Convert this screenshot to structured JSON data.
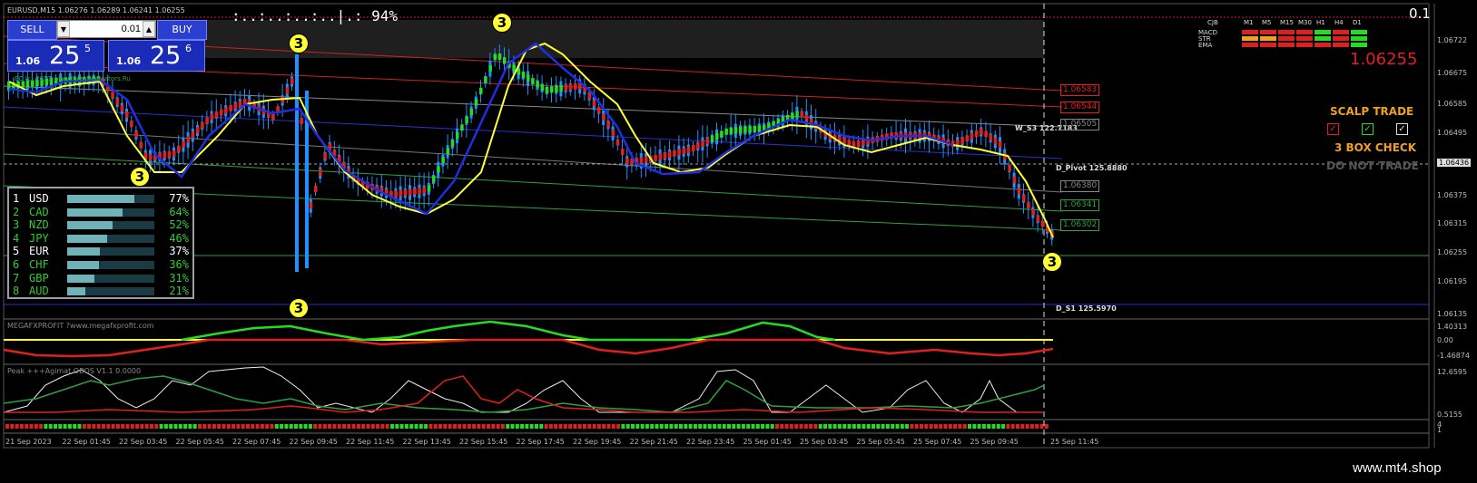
{
  "chart": {
    "symbol_line": "EURUSD,M15  1.06276 1.06289 1.06241 1.06255",
    "timer": ":..:..:..:..|.: 94%",
    "top_right_value": "0.1",
    "watermark": "www.mt4.shop",
    "credit": "EC (c) 2023 www.forex-indicators.Ru"
  },
  "trade_panel": {
    "sell_label": "SELL",
    "buy_label": "BUY",
    "lot_value": "0.01",
    "sell_price": {
      "prefix": "1.06",
      "big": "25",
      "pip": "5"
    },
    "buy_price": {
      "prefix": "1.06",
      "big": "25",
      "pip": "6"
    }
  },
  "strength": {
    "rows": [
      {
        "rank": "1",
        "code": "USD",
        "value": "77%",
        "pct": 77,
        "color": "#ffffff"
      },
      {
        "rank": "2",
        "code": "CAD",
        "value": "64%",
        "pct": 64,
        "color": "#33cc33"
      },
      {
        "rank": "3",
        "code": "NZD",
        "value": "52%",
        "pct": 52,
        "color": "#33cc33"
      },
      {
        "rank": "4",
        "code": "JPY",
        "value": "46%",
        "pct": 46,
        "color": "#33cc33"
      },
      {
        "rank": "5",
        "code": "EUR",
        "value": "37%",
        "pct": 37,
        "color": "#ffffff"
      },
      {
        "rank": "6",
        "code": "CHF",
        "value": "36%",
        "pct": 36,
        "color": "#33cc33"
      },
      {
        "rank": "7",
        "code": "GBP",
        "value": "31%",
        "pct": 31,
        "color": "#33cc33"
      },
      {
        "rank": "8",
        "code": "AUD",
        "value": "21%",
        "pct": 21,
        "color": "#33cc33"
      }
    ]
  },
  "mtf": {
    "header": [
      "CJB",
      "M1",
      "M5",
      "M15",
      "M30",
      "H1",
      "H4",
      "D1"
    ],
    "rows": [
      "MACD",
      "STR",
      "EMA"
    ],
    "price": "1.06255"
  },
  "scalp": {
    "title": "SCALP TRADE",
    "check": "3 BOX CHECK",
    "warn": "DO NOT TRADE"
  },
  "levels": {
    "w_s3": "W_S3 122.7183",
    "d_pivot": "D_Pivot 125.8880",
    "d_s1": "D_S1 125.5970"
  },
  "price_tags": [
    {
      "text": "1.06583",
      "color": "#e02020"
    },
    {
      "text": "1.06544",
      "color": "#e02020"
    },
    {
      "text": "1.06505",
      "color": "#888888"
    },
    {
      "text": "1.06380",
      "color": "#888888"
    },
    {
      "text": "1.06341",
      "color": "#2ea043"
    },
    {
      "text": "1.06302",
      "color": "#2ea043"
    }
  ],
  "price_axis": [
    "1.06722",
    "1.06675",
    "1.06585",
    "1.06495",
    "1.06436",
    "1.06375",
    "1.06315",
    "1.06255",
    "1.06195",
    "1.06135"
  ],
  "indicators": {
    "mega_label": "MEGAFXPROFIT ?www.megafxprofit.com",
    "mega_axis": [
      "1.40313",
      "0.00",
      "-1.46874"
    ],
    "peak_label": "Peak  +++Agimat OBOS V1.1 0.0000",
    "peak_axis": [
      "12.6595",
      "0.5155"
    ],
    "bottom_axis": [
      "4",
      "1"
    ]
  },
  "time_axis": [
    "21 Sep 2023",
    "22 Sep 01:45",
    "22 Sep 03:45",
    "22 Sep 05:45",
    "22 Sep 07:45",
    "22 Sep 09:45",
    "22 Sep 11:45",
    "22 Sep 13:45",
    "22 Sep 15:45",
    "22 Sep 17:45",
    "22 Sep 19:45",
    "22 Sep 21:45",
    "22 Sep 23:45",
    "25 Sep 01:45",
    "25 Sep 03:45",
    "25 Sep 05:45",
    "25 Sep 07:45",
    "25 Sep 09:45",
    "25 Sep 11:45"
  ],
  "markers": {
    "three": "3"
  }
}
